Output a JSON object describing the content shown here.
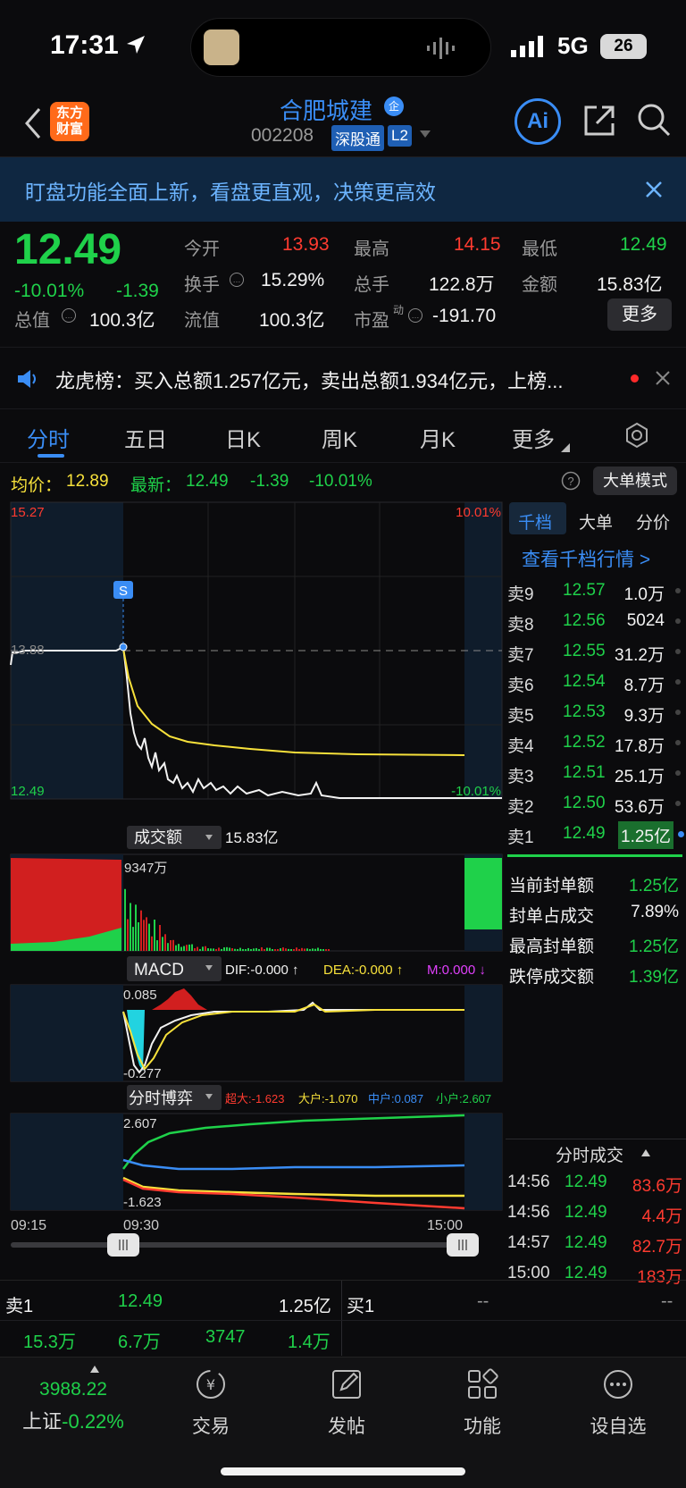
{
  "status_bar": {
    "time": "17:31",
    "network": "5G",
    "battery": "26"
  },
  "header": {
    "logo_line1": "东方",
    "logo_line2": "财富",
    "stock_name": "合肥城建",
    "badge": "企",
    "stock_code": "002208",
    "tag_sz": "深股通",
    "tag_l2": "L2",
    "ai_label": "Ai"
  },
  "banner": {
    "text": "盯盘功能全面上新，看盘更直观，决策更高效"
  },
  "quote": {
    "price": "12.49",
    "change_pct": "-10.01%",
    "change": "-1.39",
    "open_label": "今开",
    "open": "13.93",
    "high_label": "最高",
    "high": "14.15",
    "low_label": "最低",
    "low": "12.49",
    "turnover_label": "换手",
    "turnover": "15.29%",
    "volume_label": "总手",
    "volume": "122.8万",
    "amount_label": "金额",
    "amount": "15.83亿",
    "mcap_label": "总值",
    "mcap": "100.3亿",
    "float_label": "流值",
    "float_mcap": "100.3亿",
    "pe_label": "市盈",
    "pe_sup": "动",
    "pe": "-191.70",
    "more_button": "更多"
  },
  "notice": {
    "text": "龙虎榜：买入总额1.257亿元，卖出总额1.934亿元，上榜..."
  },
  "tabs": [
    "分时",
    "五日",
    "日K",
    "周K",
    "月K",
    "更多"
  ],
  "info": {
    "avg_label": "均价：",
    "avg": "12.89",
    "latest_label": "最新：",
    "latest": "12.49",
    "latest_chg": "-1.39",
    "latest_pct": "-10.01%",
    "big_order_button": "大单模式"
  },
  "chart": {
    "y_high": "15.27",
    "y_low": "12.49",
    "y_mid": "13.88",
    "pct_high": "10.01%",
    "pct_low": "-10.01%",
    "marker_label": "S",
    "vol_label": "成交额",
    "vol_value": "15.83亿",
    "vol_axis": "9347万",
    "macd_label": "MACD",
    "dif": "DIF:-0.000 ↑",
    "dea": "DEA:-0.000 ↑",
    "m": "M:0.000 ↓",
    "macd_top": "0.085",
    "macd_bottom": "-0.277",
    "game_label": "分时博弈",
    "super": "超大:-1.623",
    "large": "大户:-1.070",
    "mid": "中户:0.087",
    "small": "小户:2.607",
    "game_top": "2.607",
    "game_bottom": "-1.623",
    "time_start": "09:15",
    "time_open": "09:30",
    "time_end": "15:00"
  },
  "book": {
    "tabs": [
      "千档",
      "大单",
      "分价"
    ],
    "link": "查看千档行情 >",
    "asks": [
      {
        "label": "卖9",
        "price": "12.57",
        "vol": "1.0万"
      },
      {
        "label": "卖8",
        "price": "12.56",
        "vol": "5024"
      },
      {
        "label": "卖7",
        "price": "12.55",
        "vol": "31.2万"
      },
      {
        "label": "卖6",
        "price": "12.54",
        "vol": "8.7万"
      },
      {
        "label": "卖5",
        "price": "12.53",
        "vol": "9.3万"
      },
      {
        "label": "卖4",
        "price": "12.52",
        "vol": "17.8万"
      },
      {
        "label": "卖3",
        "price": "12.51",
        "vol": "25.1万"
      },
      {
        "label": "卖2",
        "price": "12.50",
        "vol": "53.6万"
      },
      {
        "label": "卖1",
        "price": "12.49",
        "vol": "1.25亿"
      }
    ],
    "seal": [
      {
        "label": "当前封单额",
        "value": "1.25亿"
      },
      {
        "label": "封单占成交",
        "value": "7.89%"
      },
      {
        "label": "最高封单额",
        "value": "1.25亿"
      },
      {
        "label": "跌停成交额",
        "value": "1.39亿"
      }
    ],
    "trades_title": "分时成交",
    "trades": [
      {
        "time": "14:56",
        "price": "12.49",
        "vol": "83.6万"
      },
      {
        "time": "14:56",
        "price": "12.49",
        "vol": "4.4万"
      },
      {
        "time": "14:57",
        "price": "12.49",
        "vol": "82.7万"
      },
      {
        "time": "15:00",
        "price": "12.49",
        "vol": "183万"
      }
    ]
  },
  "bottom_strip": {
    "sell1_label": "卖1",
    "sell1_price": "12.49",
    "sell1_vol": "1.25亿",
    "buy1_label": "买1",
    "buy1_price": "--",
    "buy1_vol": "--",
    "v1": "15.3万",
    "v2": "6.7万",
    "v3": "3747",
    "v4": "1.4万"
  },
  "nav": {
    "index_value": "3988.22",
    "index_name": "上证",
    "index_pct": "-0.22%",
    "trade": "交易",
    "post": "发帖",
    "functions": "功能",
    "watchlist": "设自选"
  }
}
